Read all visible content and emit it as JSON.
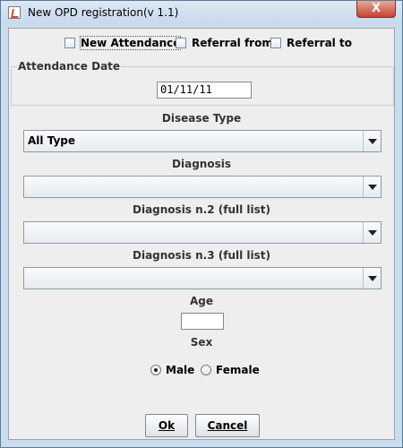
{
  "window": {
    "title": "New OPD registration(v 1.1)",
    "close_symbol": "X"
  },
  "attendance_type": {
    "options": [
      {
        "label": "New Attendance",
        "checked": false
      },
      {
        "label": "Referral from",
        "checked": false
      },
      {
        "label": "Referral to",
        "checked": false
      }
    ]
  },
  "attendance_date": {
    "group_title": "Attendance Date",
    "value": "01/11/11"
  },
  "disease_type": {
    "label": "Disease Type",
    "selected": "All Type"
  },
  "diagnosis": {
    "label": "Diagnosis",
    "selected": ""
  },
  "diagnosis2": {
    "label": "Diagnosis n.2 (full list)",
    "selected": ""
  },
  "diagnosis3": {
    "label": "Diagnosis n.3 (full list)",
    "selected": ""
  },
  "age": {
    "label": "Age",
    "value": ""
  },
  "sex": {
    "label": "Sex",
    "options": [
      {
        "label": "Male",
        "selected": true
      },
      {
        "label": "Female",
        "selected": false
      }
    ]
  },
  "buttons": {
    "ok_label": "Ok",
    "cancel_label": "Cancel"
  }
}
